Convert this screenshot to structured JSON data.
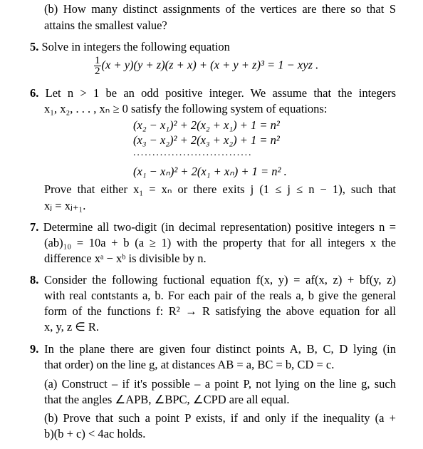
{
  "problems": {
    "p4b": {
      "line1": "(b) How many distinct assignments of the vertices are there so that S",
      "line2": "attains the smallest value?"
    },
    "p5": {
      "number": "5.",
      "text": "Solve in integers the following equation",
      "equation": {
        "frac_num": "1",
        "frac_den": "2",
        "body": "(x + y)(y + z)(z + x) + (x + y + z)³ = 1 − xyz ."
      }
    },
    "p6": {
      "number": "6.",
      "line1": "Let n > 1 be an odd positive integer.  We assume that the integers",
      "line2": "x₁, x₂, . . . , xₙ ≥ 0 satisfy the following system of equations:",
      "eq1": "(x₂ − x₁)² + 2(x₂ + x₁) + 1 = n²",
      "eq2": "(x₃ − x₂)² + 2(x₃ + x₂) + 1 = n²",
      "dots": "...............................",
      "eq3": "(x₁ − xₙ)² + 2(x₁ + xₙ) + 1 = n² .",
      "line3": "Prove that either x₁ = xₙ or there exits j (1 ≤ j ≤ n − 1), such that",
      "line4": "xⱼ = xⱼ₊₁."
    },
    "p7": {
      "number": "7.",
      "line1": "Determine all two-digit (in decimal representation) positive integers n =",
      "line2": "(ab)₁₀ = 10a + b (a ≥ 1) with the property that for all integers x the",
      "line3": "difference xᵃ − xᵇ is divisible by n."
    },
    "p8": {
      "number": "8.",
      "line1": "Consider the following fuctional equation  f(x, y) = af(x, z) + bf(y, z)",
      "line2": "with real contstants a, b.  For each pair of the reals a, b give the general",
      "line3": "form of the functions f: R² → R satisfying the above equation for all",
      "line4": "x, y, z ∈ R."
    },
    "p9": {
      "number": "9.",
      "line1": "In the plane there are given four distinct points A, B, C, D lying (in",
      "line2": "that order) on the line g, at distances AB = a, BC = b, CD = c.",
      "a_line1": "(a) Construct – if it's possible – a point P, not lying on the line g, such",
      "a_line2": "that the angles ∠APB, ∠BPC, ∠CPD are all equal.",
      "b_line1": "(b) Prove that such a point P exists, if and only if the inequality (a +",
      "b_line2": "b)(b + c) < 4ac holds."
    }
  }
}
